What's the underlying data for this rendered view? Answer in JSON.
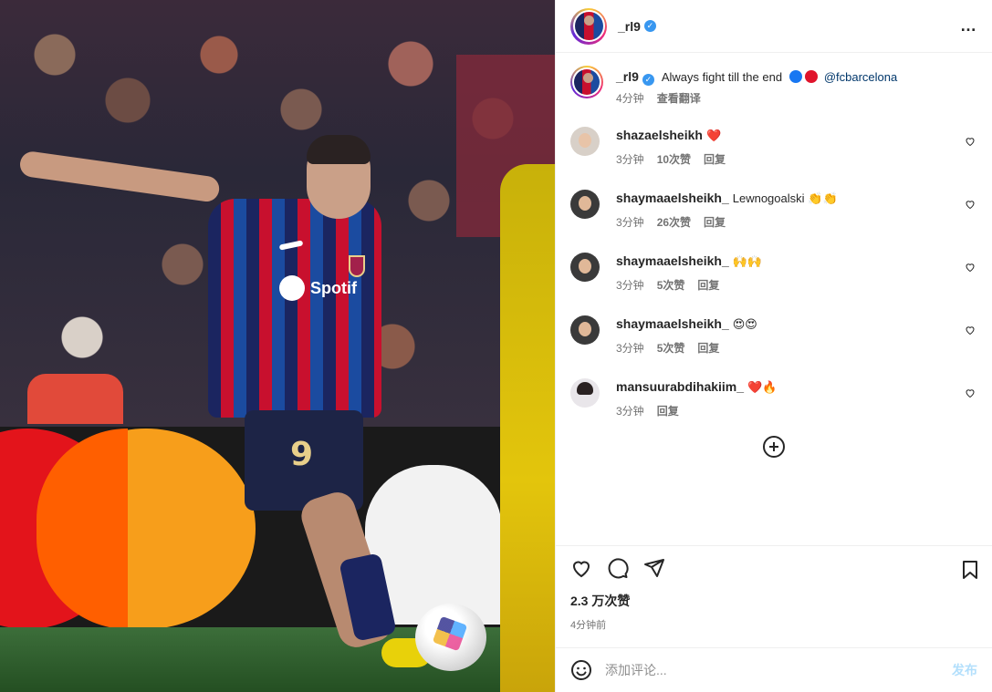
{
  "post": {
    "username": "_rl9",
    "verified_mark": "✓",
    "more_icon": "…",
    "caption_text": "Always fight till the end",
    "caption_colors": [
      "#1877f2",
      "#e0142c"
    ],
    "mention": "@fcbarcelona",
    "caption_time": "4分钟",
    "translate_label": "查看翻译"
  },
  "comments": [
    {
      "username": "shazaelsheikh",
      "text": "",
      "emoji": "❤️",
      "time": "3分钟",
      "likes": "10次赞",
      "reply": "回复"
    },
    {
      "username": "shaymaaelsheikh_",
      "text": "Lewnogoalski",
      "emoji": "👏👏",
      "time": "3分钟",
      "likes": "26次赞",
      "reply": "回复"
    },
    {
      "username": "shaymaaelsheikh_",
      "text": "",
      "emoji": "🙌🙌",
      "time": "3分钟",
      "likes": "5次赞",
      "reply": "回复"
    },
    {
      "username": "shaymaaelsheikh_",
      "text": "",
      "emoji": "😍😍",
      "time": "3分钟",
      "likes": "5次赞",
      "reply": "回复"
    },
    {
      "username": "mansuurabdihakiim_",
      "text": "",
      "emoji": "❤️🔥",
      "time": "3分钟",
      "likes": "",
      "reply": "回复"
    }
  ],
  "footer": {
    "likes_count": "2.3 万次赞",
    "posted_time": "4分钟前",
    "comment_placeholder": "添加评论...",
    "post_label": "发布"
  },
  "colors": {
    "accent": "#0095f6",
    "verified": "#3897f0",
    "muted": "#737373"
  }
}
